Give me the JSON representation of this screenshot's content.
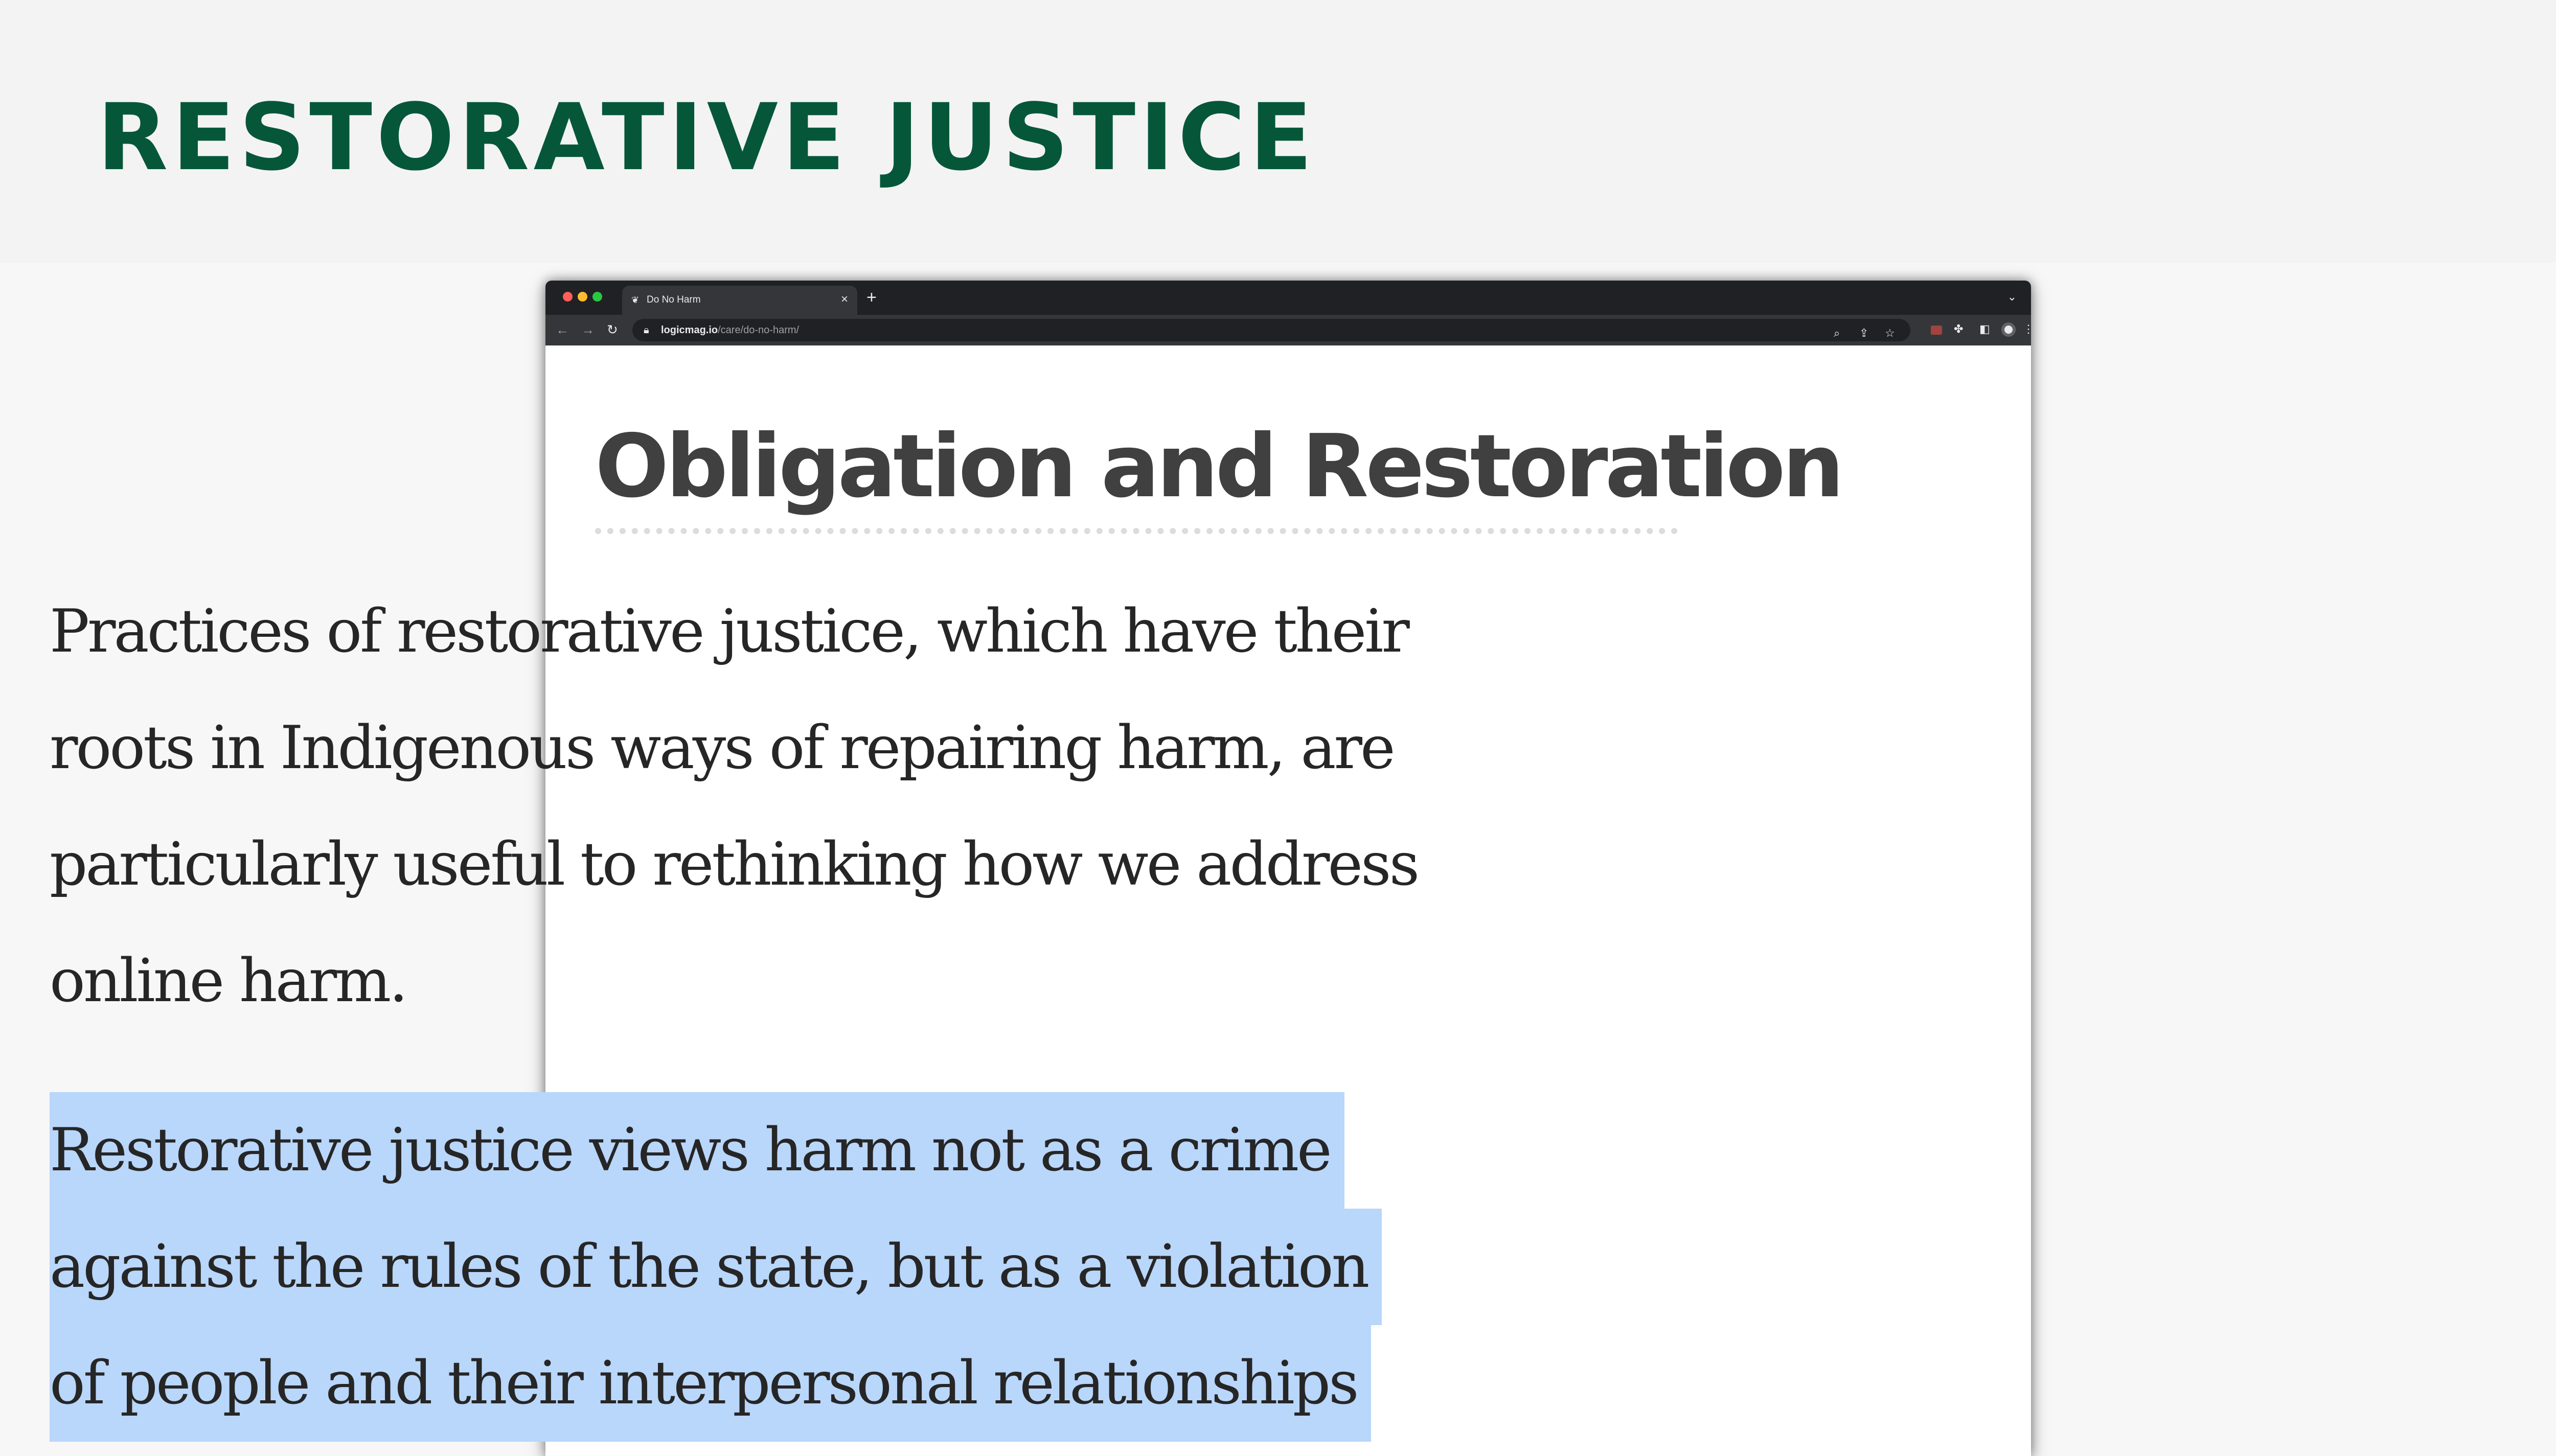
{
  "slide": {
    "title": "RESTORATIVE JUSTICE"
  },
  "browser": {
    "tab_title": "Do No Harm",
    "tab_close": "×",
    "new_tab": "+",
    "tab_menu": "⌄",
    "url_domain": "logicmag.io",
    "url_path": "/care/do-no-harm/"
  },
  "article": {
    "heading": "Obligation and Restoration",
    "paragraph_1_lines": [
      "Practices of restorative justice, which have their",
      "roots in Indigenous ways of repairing harm, are",
      "particularly useful to rethinking how we address",
      "online harm."
    ],
    "paragraph_2_lines": [
      "Restorative justice views harm not as a crime",
      "against the rules of the state, but as a violation",
      "of people and their interpersonal relationships"
    ],
    "paragraph_2_selected": true
  },
  "colors": {
    "title_green": "#06573a",
    "selection_blue": "#b9d6fb",
    "heading_gray": "#404040"
  },
  "icons": [
    "favicon-icon",
    "back-arrow-icon",
    "forward-arrow-icon",
    "reload-icon",
    "lock-icon",
    "zoom-icon",
    "share-icon",
    "bookmark-star-icon",
    "extension-icon",
    "puzzle-icon",
    "sidebar-icon",
    "profile-avatar-icon",
    "kebab-menu-icon"
  ]
}
